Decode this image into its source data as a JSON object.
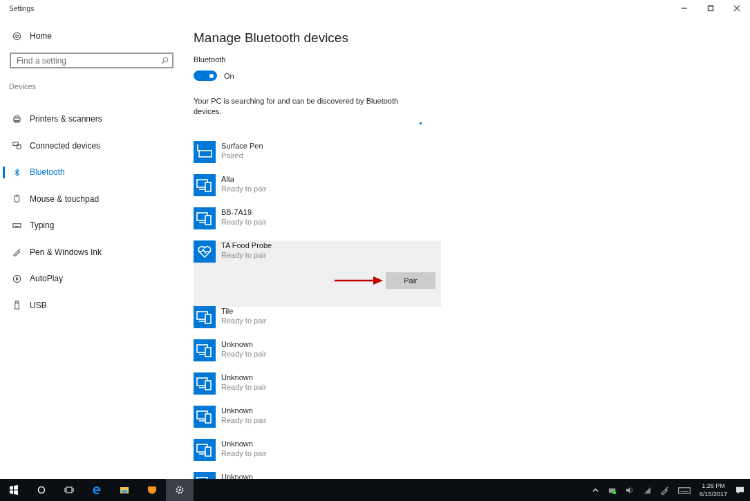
{
  "window": {
    "title": "Settings"
  },
  "sidebar": {
    "home": "Home",
    "search": {
      "placeholder": "Find a setting"
    },
    "section": "Devices",
    "items": [
      {
        "label": "Printers & scanners",
        "kind": "printer",
        "selected": false
      },
      {
        "label": "Connected devices",
        "kind": "devices",
        "selected": false
      },
      {
        "label": "Bluetooth",
        "kind": "bluetooth",
        "selected": true
      },
      {
        "label": "Mouse & touchpad",
        "kind": "mouse",
        "selected": false
      },
      {
        "label": "Typing",
        "kind": "keyboard",
        "selected": false
      },
      {
        "label": "Pen & Windows Ink",
        "kind": "pen",
        "selected": false
      },
      {
        "label": "AutoPlay",
        "kind": "autoplay",
        "selected": false
      },
      {
        "label": "USB",
        "kind": "usb",
        "selected": false
      }
    ]
  },
  "main": {
    "title": "Manage Bluetooth devices",
    "toggle_label": "Bluetooth",
    "toggle": {
      "on": true,
      "label": "On"
    },
    "status": "Your PC is searching for and can be discovered by Bluetooth devices.",
    "devices": [
      {
        "name": "Surface Pen",
        "status": "Paired",
        "kind": "pen",
        "selected": false
      },
      {
        "name": "Alta",
        "status": "Ready to pair",
        "kind": "device",
        "selected": false
      },
      {
        "name": "BB-7A19",
        "status": "Ready to pair",
        "kind": "device",
        "selected": false
      },
      {
        "name": "TA Food Probe",
        "status": "Ready to pair",
        "kind": "health",
        "selected": true,
        "button": "Pair"
      },
      {
        "name": "Tile",
        "status": "Ready to pair",
        "kind": "device",
        "selected": false
      },
      {
        "name": "Unknown",
        "status": "Ready to pair",
        "kind": "device",
        "selected": false
      },
      {
        "name": "Unknown",
        "status": "Ready to pair",
        "kind": "device",
        "selected": false
      },
      {
        "name": "Unknown",
        "status": "Ready to pair",
        "kind": "device",
        "selected": false
      },
      {
        "name": "Unknown",
        "status": "Ready to pair",
        "kind": "device",
        "selected": false
      },
      {
        "name": "Unknown",
        "kind": "device",
        "selected": false
      }
    ]
  },
  "taskbar": {
    "time": "1:26 PM",
    "date": "6/15/2017"
  }
}
